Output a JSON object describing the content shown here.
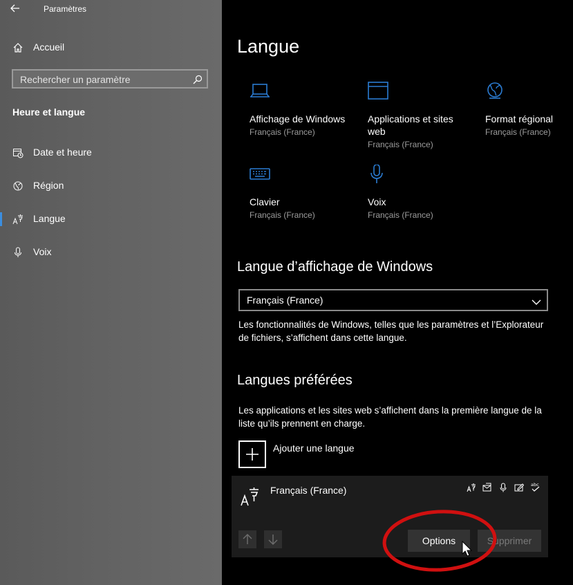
{
  "app": {
    "title": "Paramètres"
  },
  "sidebar": {
    "home_label": "Accueil",
    "search_placeholder": "Rechercher un paramètre",
    "section_title": "Heure et langue",
    "items": [
      {
        "label": "Date et heure",
        "icon": "date-time-icon"
      },
      {
        "label": "Région",
        "icon": "region-globe-icon"
      },
      {
        "label": "Langue",
        "icon": "language-icon",
        "selected": true
      },
      {
        "label": "Voix",
        "icon": "microphone-icon"
      }
    ]
  },
  "main": {
    "page_title": "Langue",
    "tiles": [
      {
        "title": "Affichage de Windows",
        "subtitle": "Français (France)",
        "icon": "laptop-icon"
      },
      {
        "title": "Applications et sites web",
        "subtitle": "Français (France)",
        "icon": "window-icon"
      },
      {
        "title": "Format régional",
        "subtitle": "Français (France)",
        "icon": "globe-icon"
      },
      {
        "title": "Clavier",
        "subtitle": "Français (France)",
        "icon": "keyboard-icon"
      },
      {
        "title": "Voix",
        "subtitle": "Français (France)",
        "icon": "microphone-icon"
      }
    ],
    "display_language": {
      "heading": "Langue d’affichage de Windows",
      "selected": "Français (France)",
      "description": "Les fonctionnalités de Windows, telles que les paramètres et l’Explorateur de fichiers, s’affichent dans cette langue."
    },
    "preferred": {
      "heading": "Langues préférées",
      "description": "Les applications et les sites web s’affichent dans la première langue de la liste qu’ils prennent en charge.",
      "add_label": "Ajouter une langue",
      "language_name": "Français (France)",
      "options_label": "Options",
      "remove_label": "Supprimer"
    }
  },
  "colors": {
    "accent": "#2b7cd3",
    "annotation": "#d01010"
  }
}
